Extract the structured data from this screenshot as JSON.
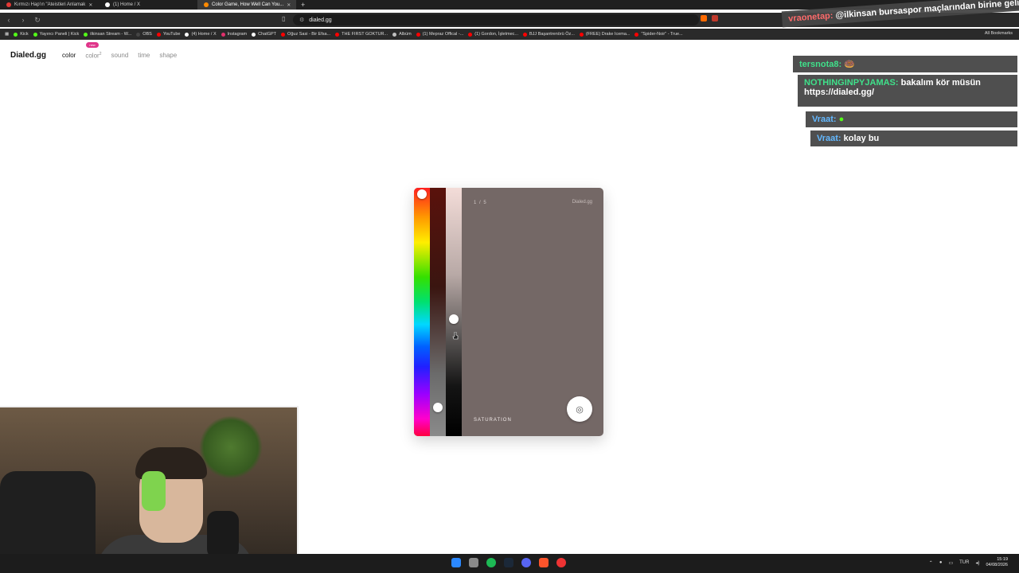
{
  "browser": {
    "tabs": [
      {
        "title": "Kırmızı Hap'ın \"Ateistleri Anlamak",
        "active": false,
        "color": "#e53935"
      },
      {
        "title": "(1) Home / X",
        "active": false,
        "color": "#ffffff"
      },
      {
        "title": "Color Game, How Well Can You...",
        "active": true,
        "color": "#ff8a00"
      }
    ],
    "new_tab_icon": "plus-icon",
    "url": "dialed.gg",
    "bookmarks": [
      {
        "label": "Kick",
        "color": "#53fc18"
      },
      {
        "label": "Yayıncı Paneli | Kick",
        "color": "#53fc18"
      },
      {
        "label": "ilkinsan Stream - W...",
        "color": "#53fc18"
      },
      {
        "label": "OBS",
        "color": "#444444"
      },
      {
        "label": "YouTube",
        "color": "#ff0000"
      },
      {
        "label": "(4) Home / X",
        "color": "#ffffff"
      },
      {
        "label": "Instagram",
        "color": "#e1306c"
      },
      {
        "label": "ChatGPT",
        "color": "#ffffff"
      },
      {
        "label": "Oğuz Sasi - Bir Efsa...",
        "color": "#ff0000"
      },
      {
        "label": "THE FIRST GOKTUR...",
        "color": "#ff0000"
      },
      {
        "label": "Albüm",
        "color": "#c0c0c0"
      },
      {
        "label": "(1) Mepraz Offical -...",
        "color": "#ff0000"
      },
      {
        "label": "(1) Gordon, İşletmec...",
        "color": "#ff0000"
      },
      {
        "label": "BJJ Başantrenörü Öz...",
        "color": "#ff0000"
      },
      {
        "label": "(FREE) Drake Icema...",
        "color": "#ff0000"
      },
      {
        "label": "\"Spider-Noir\" - True...",
        "color": "#ff0000"
      }
    ],
    "all_bookmarks": "All Bookmarks"
  },
  "site": {
    "logo": "Dialed.gg",
    "nav": {
      "color": "color",
      "color2": "color",
      "color2_sup": "2",
      "sound": "sound",
      "time": "time",
      "shape": "shape",
      "new_badge": "new"
    }
  },
  "game": {
    "progress": "1 / 5",
    "brand": "Dialed.gg",
    "mode_label": "SATURATION",
    "current_color": "#746866",
    "submit_icon": "fingerprint-icon"
  },
  "chat": [
    {
      "user": "vraonetap:",
      "text": "@ilkinsan bursaspor maçlarından birine gelmeyi planlıyor musun",
      "user_color": "#ff6b6b"
    },
    {
      "user": "tersnota8:",
      "text": "",
      "user_color": "#3fe08a"
    },
    {
      "user": "NOTHINGINPYJAMAS:",
      "text": "bakalım kör müsün https://dialed.gg/",
      "user_color": "#3fe08a"
    },
    {
      "user": "Vraat:",
      "text": "",
      "user_color": "#63b8ff"
    },
    {
      "user": "Vraat:",
      "text": "kolay bu",
      "user_color": "#63b8ff"
    }
  ],
  "taskbar": {
    "lang": "TUR",
    "time": "15:19",
    "date": "04/08/2026"
  }
}
